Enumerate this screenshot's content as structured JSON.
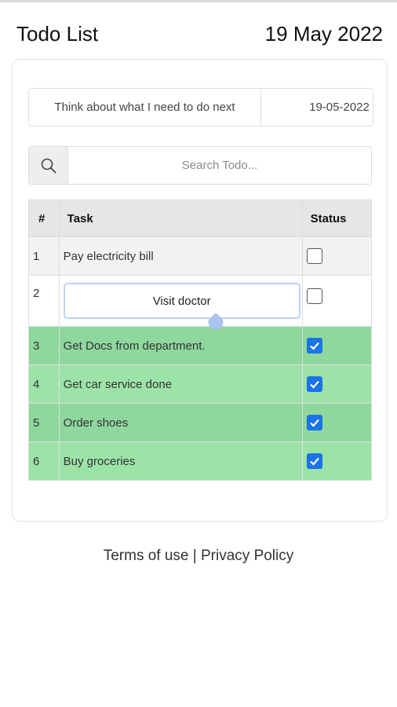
{
  "header": {
    "title": "Todo List",
    "date": "19 May 2022"
  },
  "add_form": {
    "task_value": "Think about what I need to do next",
    "date_value": "19-05-2022",
    "add_icon": "plus-icon"
  },
  "search": {
    "placeholder": "Search Todo...",
    "icon": "search-icon"
  },
  "table": {
    "headers": {
      "num": "#",
      "task": "Task",
      "status": "Status"
    },
    "rows": [
      {
        "num": "1",
        "task": "Pay electricity bill",
        "done": false
      },
      {
        "num": "2",
        "task": "Visit doctor",
        "done": false,
        "editing": true
      },
      {
        "num": "3",
        "task": "Get Docs from department.",
        "done": true
      },
      {
        "num": "4",
        "task": "Get car service done",
        "done": true
      },
      {
        "num": "5",
        "task": "Order shoes",
        "done": true
      },
      {
        "num": "6",
        "task": "Buy groceries",
        "done": true
      }
    ]
  },
  "footer": {
    "terms": "Terms of use",
    "separator": "|",
    "privacy": "Privacy Policy"
  },
  "colors": {
    "done_row": "#8ed79d",
    "done_row_alt": "#9ce3a8",
    "checkbox_checked": "#1a73e8",
    "edit_border": "#bcd2f4"
  }
}
